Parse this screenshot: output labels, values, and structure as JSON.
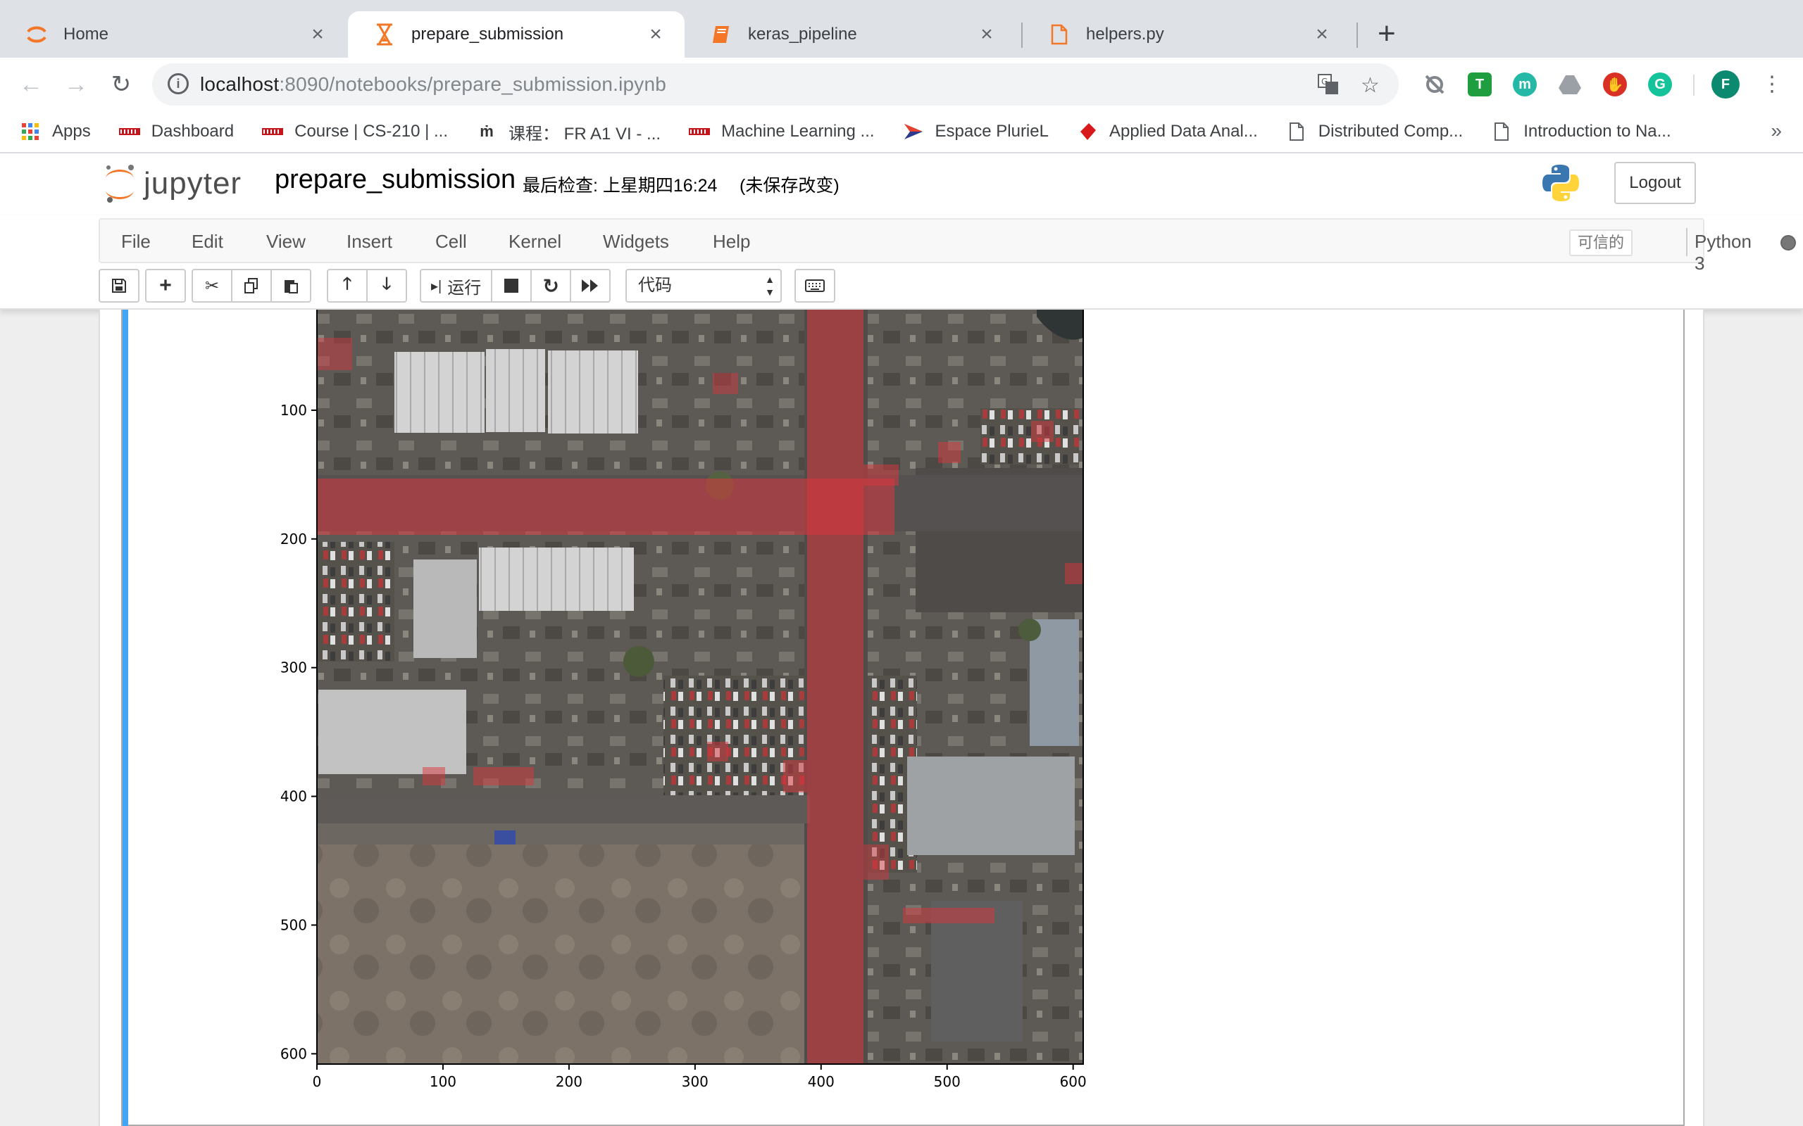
{
  "tabs": [
    {
      "title": "Home",
      "icon": "jupyter-icon",
      "active": false
    },
    {
      "title": "prepare_submission",
      "icon": "hourglass-icon",
      "active": true
    },
    {
      "title": "keras_pipeline",
      "icon": "notebook-icon",
      "active": false
    },
    {
      "title": "helpers.py",
      "icon": "file-icon",
      "active": false
    }
  ],
  "address": {
    "host": "localhost",
    "rest": ":8090/notebooks/prepare_submission.ipynb"
  },
  "profile_initial": "F",
  "bookmarks": [
    {
      "label": "Apps",
      "icon": "apps-grid-icon"
    },
    {
      "label": "Dashboard",
      "icon": "moodle-icon"
    },
    {
      "label": "Course | CS-210 | ...",
      "icon": "moodle-icon"
    },
    {
      "label": "课程： FR A1 VI - ...",
      "icon": "mooc-icon"
    },
    {
      "label": "Machine Learning ...",
      "icon": "moodle-icon"
    },
    {
      "label": "Espace PlurieL",
      "icon": "arrow-logo-icon"
    },
    {
      "label": "Applied Data Anal...",
      "icon": "dlab-icon"
    },
    {
      "label": "Distributed Comp...",
      "icon": "page-icon"
    },
    {
      "label": "Introduction to Na...",
      "icon": "page-icon"
    }
  ],
  "jupyter": {
    "logo_text": "jupyter",
    "notebook_name": "prepare_submission",
    "checkpoint": "最后检查: 上星期四16:24",
    "unsaved": "(未保存改变)",
    "logout": "Logout",
    "menus": [
      "File",
      "Edit",
      "View",
      "Insert",
      "Cell",
      "Kernel",
      "Widgets",
      "Help"
    ],
    "trusted": "可信的",
    "kernel": "Python 3",
    "run_label": "运行",
    "cell_type": "代码"
  },
  "chart_data": {
    "type": "image",
    "description_visible": "aerial image with red road-mask overlay",
    "x_ticks": [
      0,
      100,
      200,
      300,
      400,
      500,
      600
    ],
    "y_ticks": [
      100,
      200,
      300,
      400,
      500,
      600
    ],
    "xlim": [
      0,
      608
    ],
    "ylim_visible": [
      0,
      608
    ],
    "overlay_color": "#d9363e"
  }
}
